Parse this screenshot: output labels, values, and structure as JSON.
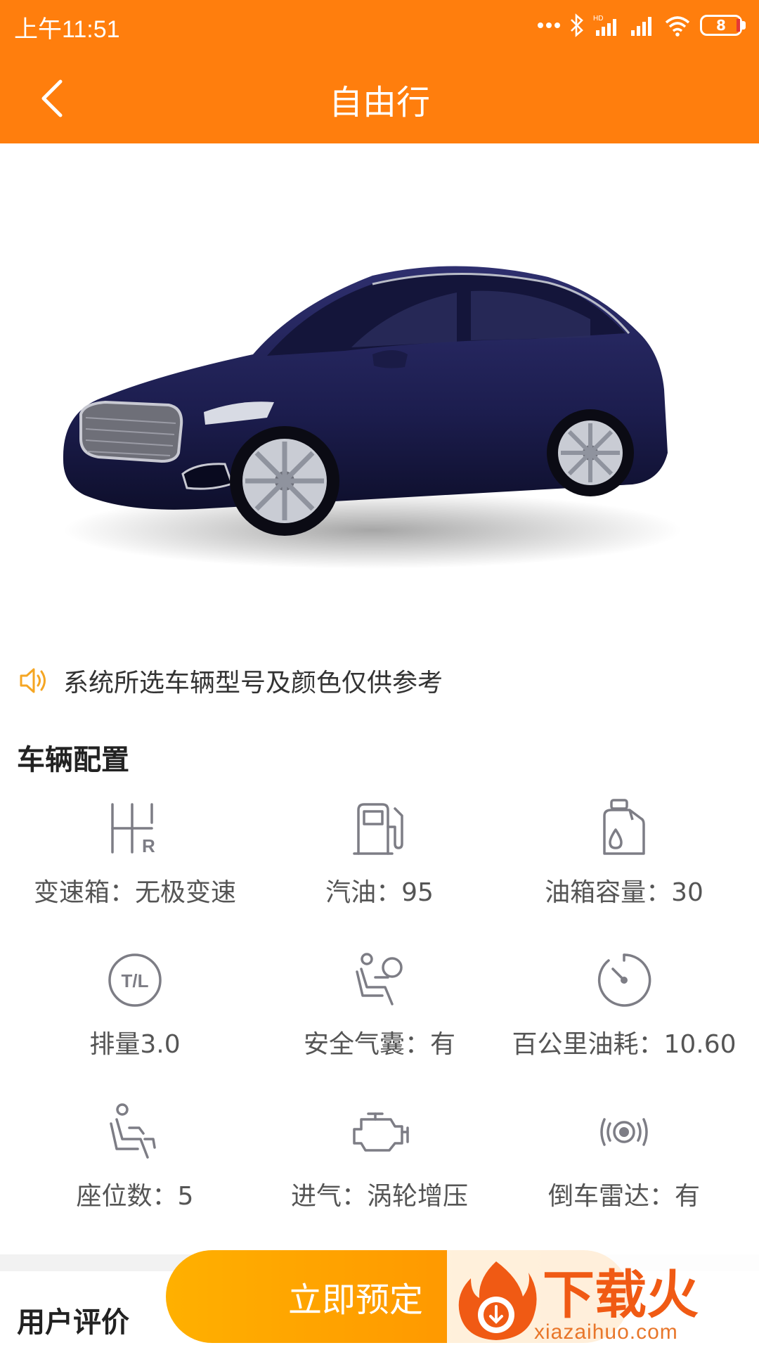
{
  "status_bar": {
    "time": "上午11:51",
    "battery": "8"
  },
  "header": {
    "title": "自由行"
  },
  "notice": {
    "text": "系统所选车辆型号及颜色仅供参考"
  },
  "config": {
    "title": "车辆配置",
    "items": [
      {
        "icon": "gearbox-icon",
        "label": "变速箱：无极变速"
      },
      {
        "icon": "fuel-pump-icon",
        "label": "汽油：95"
      },
      {
        "icon": "oil-can-icon",
        "label": "油箱容量：30"
      },
      {
        "icon": "tl-displacement-icon",
        "label": "排量3.0"
      },
      {
        "icon": "airbag-icon",
        "label": "安全气囊：有"
      },
      {
        "icon": "gauge-icon",
        "label": "百公里油耗：10.60"
      },
      {
        "icon": "seat-icon",
        "label": "座位数：5"
      },
      {
        "icon": "engine-icon",
        "label": "进气：涡轮增压"
      },
      {
        "icon": "radar-icon",
        "label": "倒车雷达：有"
      }
    ]
  },
  "reviews": {
    "title": "用户评价"
  },
  "actions": {
    "book_label": "立即预定"
  },
  "watermark": {
    "brand": "下载火",
    "url": "xiazaihuo.com"
  },
  "colors": {
    "accent": "#ff7e0d",
    "button_start": "#ffb000",
    "button_end": "#ff8a00",
    "icon_gray": "#7d7d85"
  }
}
